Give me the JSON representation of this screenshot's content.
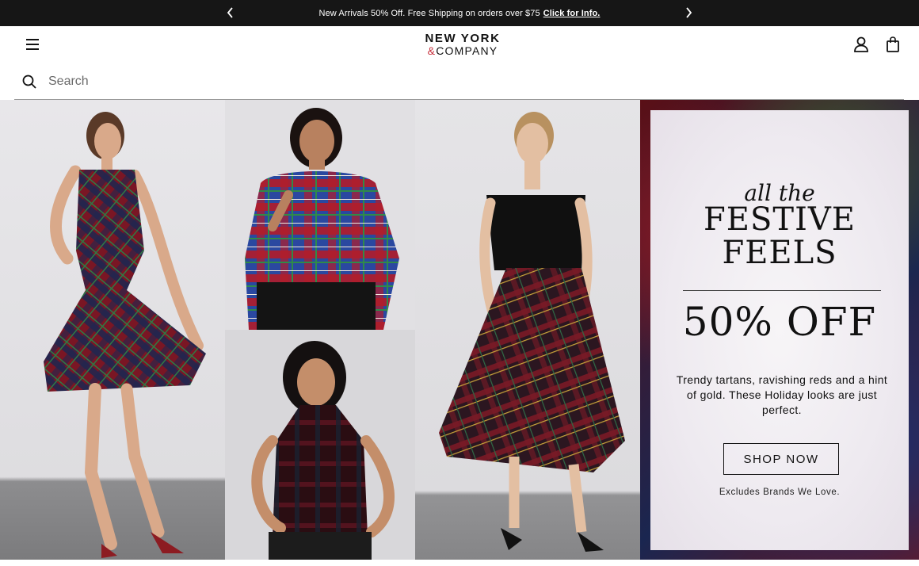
{
  "announcement": {
    "message": "New Arrivals 50% Off. Free Shipping on orders over $75",
    "link": "Click for Info.",
    "prev_icon": "chevron-left-icon",
    "next_icon": "chevron-right-icon"
  },
  "header": {
    "logo_line1": "NEW YORK",
    "logo_amp": "&",
    "logo_line2": "COMPANY",
    "menu_icon": "hamburger-icon",
    "account_icon": "user-icon",
    "bag_icon": "shopping-bag-icon"
  },
  "search": {
    "placeholder": "Search",
    "icon": "search-icon"
  },
  "hero": {
    "script": "all the",
    "headline_line1": "FESTIVE",
    "headline_line2": "FEELS",
    "discount": "50% OFF",
    "copy": "Trendy tartans, ravishing reds and a hint of gold. These Holiday looks are just perfect.",
    "cta": "SHOP NOW",
    "fine_print": "Excludes Brands We Love."
  },
  "colors": {
    "announcement_bg": "#161616",
    "logo_accent": "#c7303c",
    "text": "#111111"
  }
}
